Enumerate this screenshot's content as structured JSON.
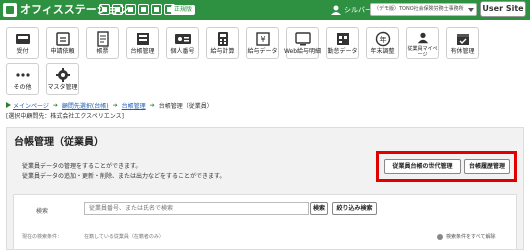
{
  "header": {
    "app_title": "オフィスステーション",
    "edition_badge": "正規版",
    "user_rank": "シルバー",
    "account_value": "（デモ版）TONO社会保険労務士事務所",
    "user_site_label": "User Site"
  },
  "menu": {
    "row1": [
      {
        "label": "受付",
        "icon": "inbox-icon"
      },
      {
        "label": "申請依頼",
        "icon": "request-icon"
      },
      {
        "label": "帳票",
        "icon": "form-icon"
      },
      {
        "label": "台帳管理",
        "icon": "ledger-icon"
      },
      {
        "label": "個人番号",
        "icon": "id-card-icon"
      },
      {
        "label": "給与計算",
        "icon": "calculator-icon"
      },
      {
        "label": "給与データ",
        "icon": "salary-data-icon"
      },
      {
        "label": "Web給与明細",
        "icon": "web-payslip-icon"
      },
      {
        "label": "勤怠データ",
        "icon": "attendance-icon"
      },
      {
        "label": "年末調整",
        "icon": "year-end-icon"
      },
      {
        "label": "従業員マイページ",
        "icon": "employee-page-icon"
      },
      {
        "label": "有休管理",
        "icon": "leave-icon"
      }
    ],
    "row2": [
      {
        "label": "その他",
        "icon": "more-icon"
      },
      {
        "label": "マスタ管理",
        "icon": "gear-icon"
      }
    ]
  },
  "breadcrumb": {
    "home": "メインページ",
    "items": [
      "顧問先選択(台帳)",
      "台帳管理",
      "台帳管理（従業員）"
    ]
  },
  "company_line": "[選択中顧問先：株式会社エクスペリエンス]",
  "panel": {
    "title": "台帳管理（従業員）",
    "desc1": "従業員データの管理をすることができます。",
    "desc2": "従業員データの追加・更新・削除、または出力などをすることができます。",
    "btn_generation": "従業員台帳の世代管理",
    "btn_history": "台帳履歴管理"
  },
  "search": {
    "label": "検索",
    "placeholder": "従業員番号、または氏名で検索",
    "search_button": "検索",
    "refine_button": "絞り込み検索",
    "current_filter_label": "現在の検索条件：",
    "current_filter_value": "在籍している従業員（在籍者のみ）",
    "clear_label": "検索条件をすべて解除"
  },
  "colors": {
    "brand_green": "#2e9141",
    "highlight_red": "#e00000",
    "link_blue": "#1a5fb4"
  }
}
